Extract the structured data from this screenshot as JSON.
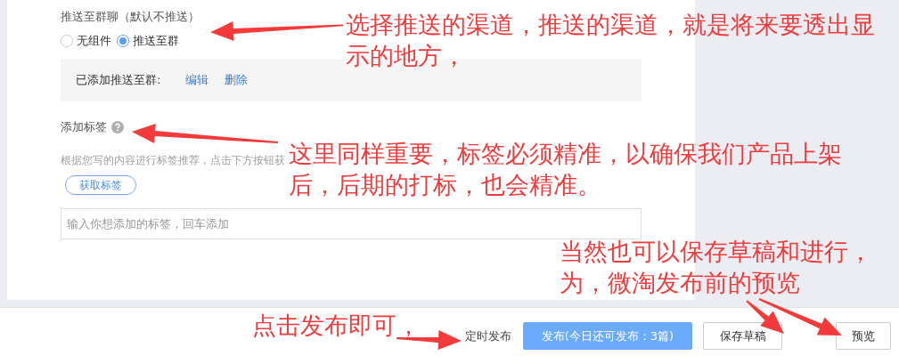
{
  "push": {
    "title": "推送至群聊（默认不推送）",
    "options": [
      {
        "label": "无组件",
        "selected": false
      },
      {
        "label": "推送至群",
        "selected": true
      }
    ],
    "added_label": "已添加推送至群:",
    "links": [
      "编辑",
      "删除"
    ]
  },
  "tags": {
    "title": "添加标签",
    "hint": "根据您写的内容进行标签推荐，点击下方按钮获",
    "fetch_button": "获取标签",
    "input": {
      "placeholder": "输入你想添加的标签，回车添加"
    }
  },
  "footer": {
    "schedule": "定时发布",
    "publish": "发布(今日还可发布：3篇)",
    "save_draft": "保存草稿",
    "preview": "预览"
  },
  "annotations": [
    "选择推送的渠道，推送的渠道，就是将来要透出显示的地方，",
    "这里同样重要，标签必须精准，以确保我们产品上架后，后期的打标，也会精准。",
    "当然也可以保存草稿和进行，为，微淘发布前的预览",
    "点击发布即可，"
  ]
}
